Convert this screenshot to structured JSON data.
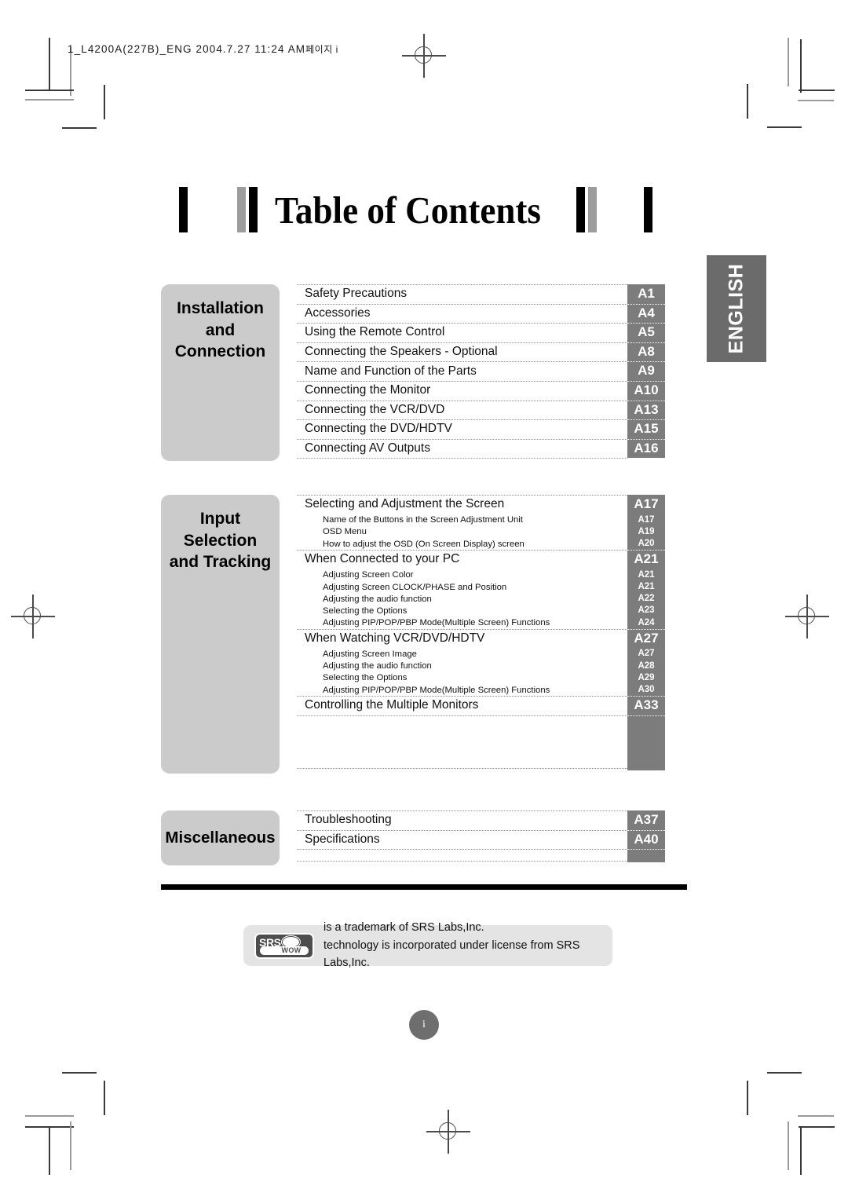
{
  "header": {
    "slug_main": "1_L4200A(227B)_ENG  2004.7.27  11:24 AM",
    "slug_korean": "페이지 i"
  },
  "title": "Table of Contents",
  "language_tab": "ENGLISH",
  "page_badge": "i",
  "colors": {
    "sidebar_gray": "#cbcbcb",
    "pagenum_gray": "#7c7c7c",
    "tab_gray": "#6b6b6b",
    "srs_box_gray": "#e4e4e4",
    "srs_logo_dark": "#4d4d4d"
  },
  "sections": [
    {
      "sidebar_label": "Installation\nand\nConnection",
      "entries": [
        {
          "level": "main",
          "label": "Safety Precautions",
          "page": "A1"
        },
        {
          "level": "main",
          "label": "Accessories",
          "page": "A4"
        },
        {
          "level": "main",
          "label": "Using the Remote Control",
          "page": "A5"
        },
        {
          "level": "main",
          "label": "Connecting the Speakers - Optional",
          "page": "A8"
        },
        {
          "level": "main",
          "label": "Name and Function of the Parts",
          "page": "A9"
        },
        {
          "level": "main",
          "label": "Connecting the Monitor",
          "page": "A10"
        },
        {
          "level": "main",
          "label": "Connecting the VCR/DVD",
          "page": "A13"
        },
        {
          "level": "main",
          "label": "Connecting the DVD/HDTV",
          "page": "A15"
        },
        {
          "level": "main",
          "label": "Connecting AV Outputs",
          "page": "A16"
        }
      ]
    },
    {
      "sidebar_label": "Input\nSelection\nand Tracking",
      "entries": [
        {
          "level": "main",
          "label": "Selecting and Adjustment the Screen",
          "page": "A17"
        },
        {
          "level": "sub",
          "label": "Name of the Buttons in the Screen Adjustment Unit",
          "page": "A17"
        },
        {
          "level": "sub",
          "label": "OSD Menu",
          "page": "A19"
        },
        {
          "level": "sub",
          "label": "How to adjust the OSD (On Screen Display) screen",
          "page": "A20"
        },
        {
          "level": "main",
          "label": "When Connected to your PC",
          "page": "A21"
        },
        {
          "level": "sub",
          "label": "Adjusting Screen Color",
          "page": "A21"
        },
        {
          "level": "sub",
          "label": "Adjusting Screen CLOCK/PHASE and Position",
          "page": "A21"
        },
        {
          "level": "sub",
          "label": "Adjusting the audio function",
          "page": "A22"
        },
        {
          "level": "sub",
          "label": "Selecting the Options",
          "page": "A23"
        },
        {
          "level": "sub",
          "label": "Adjusting PIP/POP/PBP Mode(Multiple Screen) Functions",
          "page": "A24"
        },
        {
          "level": "main",
          "label": "When Watching VCR/DVD/HDTV",
          "page": "A27"
        },
        {
          "level": "sub",
          "label": "Adjusting Screen Image",
          "page": "A27"
        },
        {
          "level": "sub",
          "label": "Adjusting the audio function",
          "page": "A28"
        },
        {
          "level": "sub",
          "label": "Selecting the Options",
          "page": "A29"
        },
        {
          "level": "sub",
          "label": "Adjusting PIP/POP/PBP Mode(Multiple Screen) Functions",
          "page": "A30"
        },
        {
          "level": "main",
          "label": "Controlling the Multiple Monitors",
          "page": "A33"
        }
      ]
    },
    {
      "sidebar_label": "Miscellaneous",
      "entries": [
        {
          "level": "main",
          "label": "Troubleshooting",
          "page": "A37"
        },
        {
          "level": "main",
          "label": "Specifications",
          "page": "A40"
        }
      ]
    }
  ],
  "trademark": {
    "logo_top": "SRS",
    "logo_bottom": "WOW",
    "line1": "is a trademark of SRS Labs,Inc.",
    "line2": "technology is incorporated under license from SRS Labs,Inc."
  }
}
